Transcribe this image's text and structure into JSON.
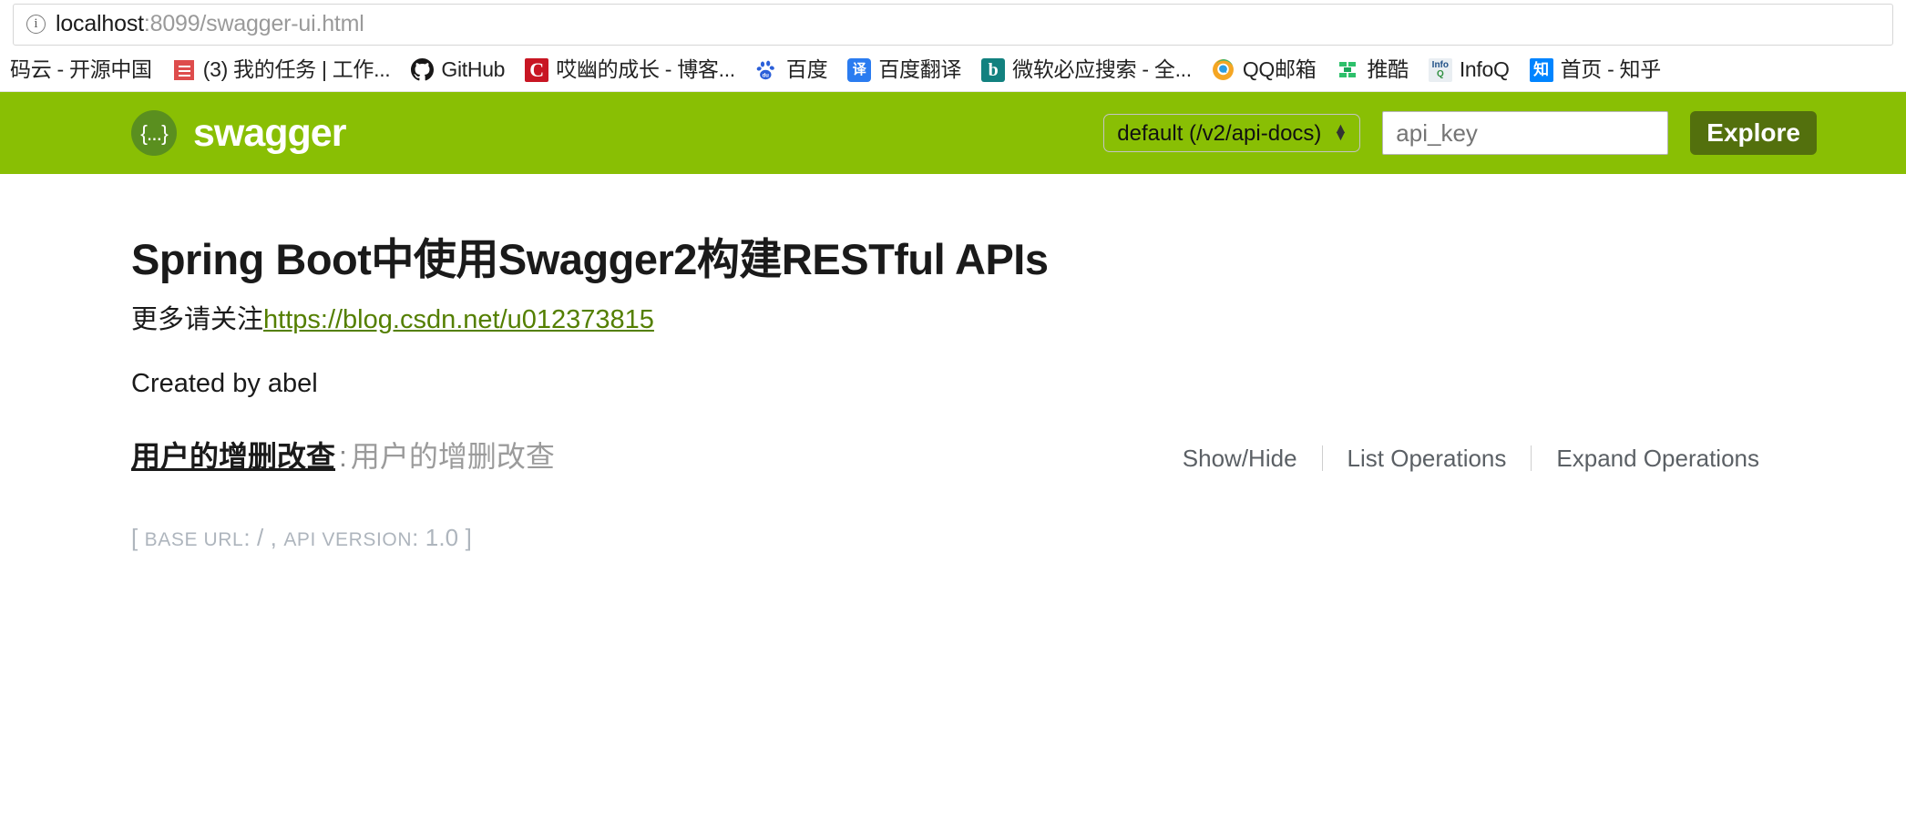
{
  "browser": {
    "omnibox": {
      "info_icon": "info-circle-icon",
      "url_host": "localhost",
      "url_rest": ":8099/swagger-ui.html",
      "url_full": "localhost:8099/swagger-ui.html"
    },
    "bookmarks": [
      {
        "label": "码云 - 开源中国",
        "icon": "none",
        "icon_glyph": ""
      },
      {
        "label": "(3) 我的任务 | 工作...",
        "icon": "task-favicon",
        "icon_glyph": ""
      },
      {
        "label": "GitHub",
        "icon": "github-favicon",
        "icon_glyph": "◉"
      },
      {
        "label": "哎幽的成长 - 博客...",
        "icon": "csdn-favicon",
        "icon_glyph": "C"
      },
      {
        "label": "百度",
        "icon": "baidu-favicon",
        "icon_glyph": "du"
      },
      {
        "label": "百度翻译",
        "icon": "baidu-fanyi-favicon",
        "icon_glyph": "译"
      },
      {
        "label": "微软必应搜索 - 全...",
        "icon": "bing-favicon",
        "icon_glyph": "b"
      },
      {
        "label": "QQ邮箱",
        "icon": "qqmail-favicon",
        "icon_glyph": "◕"
      },
      {
        "label": "推酷",
        "icon": "tuiku-favicon",
        "icon_glyph": "⊾"
      },
      {
        "label": "InfoQ",
        "icon": "infoq-favicon",
        "icon_glyph": "Info"
      },
      {
        "label": "首页 - 知乎",
        "icon": "zhihu-favicon",
        "icon_glyph": "知"
      }
    ]
  },
  "swagger_header": {
    "logo_glyph": "{...}",
    "wordmark": "swagger",
    "base_url_select": {
      "selected": "default (/v2/api-docs)",
      "options": [
        "default (/v2/api-docs)"
      ]
    },
    "api_key_input": {
      "value": "",
      "placeholder": "api_key"
    },
    "explore_label": "Explore"
  },
  "api_info": {
    "title": "Spring Boot中使用Swagger2构建RESTful APIs",
    "description_prefix": "更多请关注",
    "description_link": "https://blog.csdn.net/u012373815",
    "contact": "Created by abel"
  },
  "resources": [
    {
      "name": "用户的增删改查",
      "separator": ":",
      "description": "用户的增删改查",
      "options": [
        "Show/Hide",
        "List Operations",
        "Expand Operations"
      ]
    }
  ],
  "footer": {
    "open_bracket": "[",
    "base_url_label": "BASE URL",
    "colon_1": ":",
    "base_url_value": "/",
    "comma": ",",
    "api_version_label": "API VERSION",
    "colon_2": ":",
    "api_version_value": "1.0",
    "close_bracket": "]"
  },
  "colors": {
    "swagger_green": "#89bf04",
    "explore_green": "#53700d",
    "logo_circle": "#5a8f1f",
    "link_green": "#547f00",
    "muted_gray": "#9b9b9b",
    "footer_gray": "#aeb5bd"
  }
}
